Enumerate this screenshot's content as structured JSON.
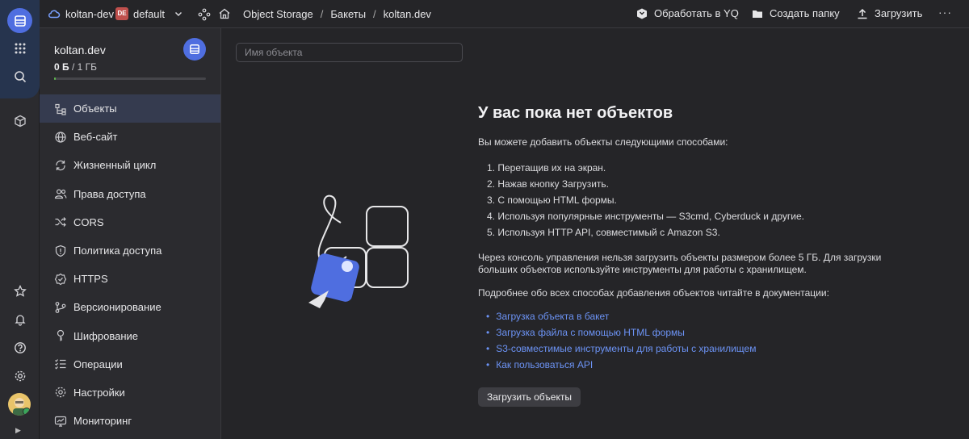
{
  "header": {
    "cloud_name": "koltan-dev",
    "folder_badge": "DE",
    "folder_name": "default",
    "breadcrumbs": [
      "Object Storage",
      "/",
      "Бакеты",
      "/",
      "koltan.dev"
    ],
    "actions": {
      "process_label": "Обработать в YQ",
      "create_folder_label": "Создать папку",
      "upload_label": "Загрузить"
    }
  },
  "bucket": {
    "name": "koltan.dev",
    "used": "0 Б",
    "separator": "/",
    "quota": "1 ГБ",
    "usage_fraction": 0.01
  },
  "sidebar": {
    "items": [
      {
        "label": "Объекты",
        "icon": "objects-icon",
        "active": true
      },
      {
        "label": "Веб-сайт",
        "icon": "globe-icon"
      },
      {
        "label": "Жизненный цикл",
        "icon": "lifecycle-icon"
      },
      {
        "label": "Права доступа",
        "icon": "users-icon"
      },
      {
        "label": "CORS",
        "icon": "shuffle-icon"
      },
      {
        "label": "Политика доступа",
        "icon": "shield-icon"
      },
      {
        "label": "HTTPS",
        "icon": "badge-check-icon"
      },
      {
        "label": "Версионирование",
        "icon": "branch-icon"
      },
      {
        "label": "Шифрование",
        "icon": "key-icon"
      },
      {
        "label": "Операции",
        "icon": "list-check-icon"
      },
      {
        "label": "Настройки",
        "icon": "gear-icon"
      },
      {
        "label": "Мониторинг",
        "icon": "monitor-icon"
      }
    ]
  },
  "search": {
    "placeholder": "Имя объекта"
  },
  "empty": {
    "title": "У вас пока нет объектов",
    "intro": "Вы можете добавить объекты следующими способами:",
    "steps": [
      "1. Перетащив их на экран.",
      "2. Нажав кнопку Загрузить.",
      "3. С помощью HTML формы.",
      "4. Используя популярные инструменты — S3cmd, Cyberduck и другие.",
      "5. Используя HTTP API, совместимый с Amazon S3."
    ],
    "limit_note": "Через консоль управления нельзя загрузить объекты размером более 5 ГБ. Для загрузки больших объектов используйте инструменты для работы с хранилищем.",
    "docs_intro": "Подробнее обо всех способах добавления объектов читайте в документации:",
    "links": [
      "Загрузка объекта в бакет",
      "Загрузка файла с помощью HTML формы",
      "S3-совместимые инструменты для работы с хранилищем",
      "Как пользоваться API"
    ],
    "button_label": "Загрузить объекты"
  },
  "colors": {
    "accent": "#4f6ee0",
    "link": "#6c93f5",
    "active_bg": "#353b4f",
    "progress": "#5fbb4f"
  }
}
